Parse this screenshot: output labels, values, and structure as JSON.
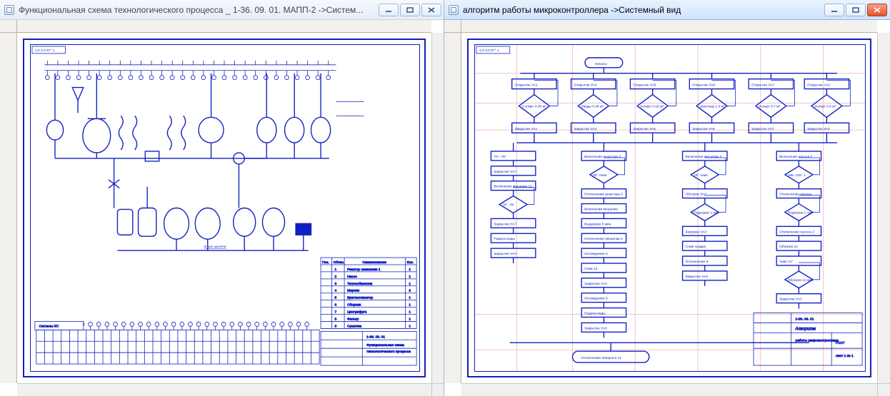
{
  "windows": {
    "left": {
      "title": "Функциональная схема  технологического процесса _ 1-36. 09. 01. МАПП-2 ->Систем...",
      "icon": "document-icon",
      "diagram": {
        "code_tl": "1.0  3.0   97° 1",
        "stamp_code": "1-36. 09. 01",
        "stamp_title_l1": "Функциональная схема",
        "stamp_title_l2": "технологического процесса",
        "spec_header": [
          "Поз.",
          "Обозн.",
          "Наименование",
          "Кол."
        ],
        "spec_rows": [
          [
            "",
            "1",
            "Реактор смешения 1",
            "1"
          ],
          [
            "",
            "2",
            "Насос",
            "1"
          ],
          [
            "",
            "3",
            "Теплообменник",
            "1"
          ],
          [
            "",
            "4",
            "Мерник",
            "2"
          ],
          [
            "",
            "5",
            "Кристаллизатор",
            "1"
          ],
          [
            "",
            "6",
            "Сборник",
            "1"
          ],
          [
            "",
            "7",
            "Центрифуга",
            "1"
          ],
          [
            "",
            "8",
            "Фильтр",
            "1"
          ],
          [
            "",
            "9",
            "Сушилка",
            "1"
          ]
        ],
        "io_table_caption": "Сигналы I/O",
        "footnote": "В цех щелочи"
      }
    },
    "right": {
      "title": "алгоритм работы микроконтроллера ->Системный вид",
      "icon": "document-icon",
      "diagram": {
        "code_tl": "1.0  3.0   97° 1",
        "start": "Начало",
        "col_open": [
          "Открытие УА1",
          "Открытие УА4",
          "Открытие УА5",
          "Открытие УА6",
          "Открытие УА7",
          "Открытие УА2"
        ],
        "col_cond": [
          "V спирт 0.60 м³",
          "Vводы 0.48 м³",
          "Vспирт 0.16 м³",
          "Vраствор 1.0 м³",
          "Vспирт 0.7 м³",
          "Vспирт 0.5 м³"
        ],
        "col_close": [
          "Закрытие УА1",
          "Закрытие УА4",
          "Закрытие УА5",
          "Закрытие УА6",
          "Закрытие УА7",
          "Закрытие УА2"
        ],
        "column2_boxes": [
          "Включение реактора 2",
          "25° темп",
          "Отключение реактора 2",
          "Включение мешалки",
          "Выдержка 5 мин",
          "Отключение мешалки 4",
          "Охлаждение 4",
          "Слив 12",
          "Закрытие УА3",
          "Охлаждение 5",
          "Подача воды",
          "Закрытие УА3"
        ],
        "column4_boxes": [
          "Включение мешалки 3",
          "16° темп",
          "Обогрев УА2",
          "Подогрев 1 час",
          "Загрузка УА3",
          "Слив осадка",
          "Отключение 9",
          "Закрытие УА3"
        ],
        "column5_boxes": [
          "Включение насоса 7",
          "189..125° 1",
          "Отключение насоса",
          "Подогрев 1 час",
          "Отключение насоса 2",
          "Обогрев 12",
          "темп 12°",
          "Обогрев 12 мин",
          "Закрытие УА3"
        ],
        "column1_boxes": [
          "70°..78°",
          "Закрытие УА7",
          "Включение мешалки 12",
          "70°..78°",
          "Закрытие УА7",
          "Подача воды",
          "Закрытие УА3"
        ],
        "end": "Отключение аппарата 11",
        "stamp_title": "Алгоритм",
        "stamp_sub": "работы микроконтроллера",
        "stamp_code": "1-36. 09. 01",
        "stamp_org": "ГОСТ",
        "stamp_sheet": "лист   1 из 1"
      }
    }
  },
  "buttons": {
    "min": "–",
    "max": "□",
    "close": "×"
  }
}
